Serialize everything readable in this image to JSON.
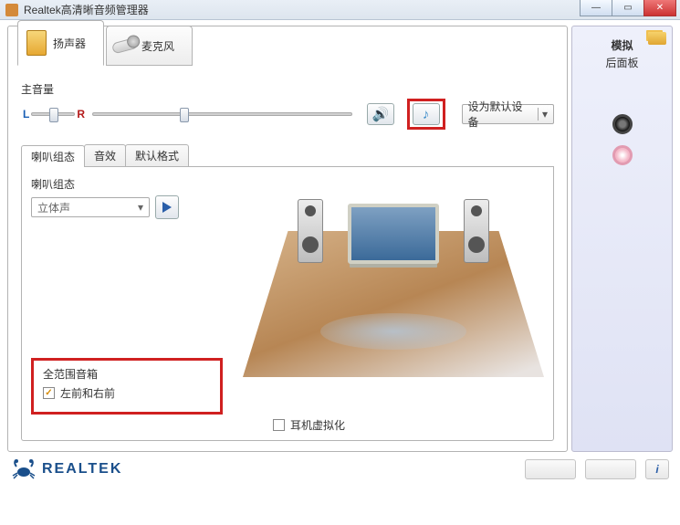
{
  "window": {
    "title": "Realtek高清晰音频管理器"
  },
  "device_tabs": {
    "speaker": {
      "label": "扬声器"
    },
    "mic": {
      "label": "麦克风"
    }
  },
  "volume": {
    "label": "主音量",
    "l": "L",
    "r": "R",
    "set_default": "设为默认设备"
  },
  "sub_tabs": {
    "config": "喇叭组态",
    "effects": "音效",
    "default_format": "默认格式"
  },
  "speaker_config": {
    "label": "喇叭组态",
    "dropdown_value": "立体声"
  },
  "full_range": {
    "title": "全范围音箱",
    "front": "左前和右前"
  },
  "headphone_virtual": "耳机虚拟化",
  "right": {
    "analog_label": "模拟",
    "back_panel": "后面板"
  },
  "brand": "REALTEK",
  "info_button": "i"
}
